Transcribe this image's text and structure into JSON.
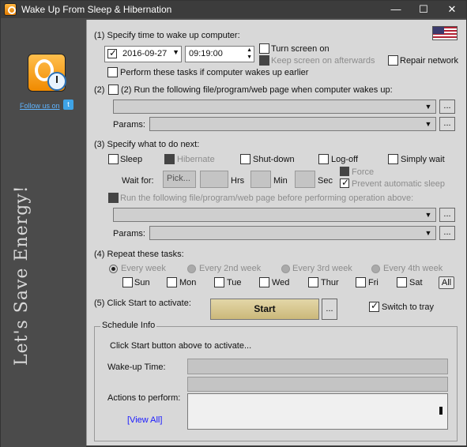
{
  "window": {
    "title": "Wake Up From Sleep & Hibernation",
    "icon": "app-icon"
  },
  "sidebar": {
    "follow_text": "Follow us on",
    "slogan": "Let's Save Energy!"
  },
  "section1": {
    "heading": "(1) Specify time to wake up computer:",
    "date_value": "2016-09-27",
    "time_value": "09:19:00",
    "turn_screen_on": "Turn screen on",
    "keep_screen_on": "Keep screen on afterwards",
    "repair_network": "Repair network",
    "perform_earlier": "Perform these tasks if computer wakes up earlier"
  },
  "section2": {
    "heading": "(2)  Run the following file/program/web page when computer wakes up:",
    "params_label": "Params:",
    "dots": "..."
  },
  "section3": {
    "heading": "(3) Specify what to do next:",
    "sleep": "Sleep",
    "hibernate": "Hibernate",
    "shutdown": "Shut-down",
    "logoff": "Log-off",
    "simply_wait": "Simply wait",
    "wait_for": "Wait for:",
    "pick": "Pick...",
    "hrs": "Hrs",
    "min": "Min",
    "sec": "Sec",
    "force": "Force",
    "prevent_sleep": "Prevent automatic sleep",
    "run_before": "Run the following file/program/web page before performing operation above:",
    "params_label": "Params:"
  },
  "section4": {
    "heading": "(4) Repeat these tasks:",
    "every_week": "Every week",
    "every_2nd": "Every 2nd week",
    "every_3rd": "Every 3rd week",
    "every_4th": "Every 4th week",
    "days": [
      "Sun",
      "Mon",
      "Tue",
      "Wed",
      "Thur",
      "Fri",
      "Sat"
    ],
    "all": "All"
  },
  "section5": {
    "heading": "(5) Click Start to activate:",
    "start": "Start",
    "dots": "...",
    "switch_tray": "Switch to tray"
  },
  "schedule": {
    "title": "Schedule Info",
    "message": "Click Start button above to activate...",
    "wakeup_label": "Wake-up Time:",
    "actions_label": "Actions to perform:",
    "view_all": "[View All]"
  }
}
